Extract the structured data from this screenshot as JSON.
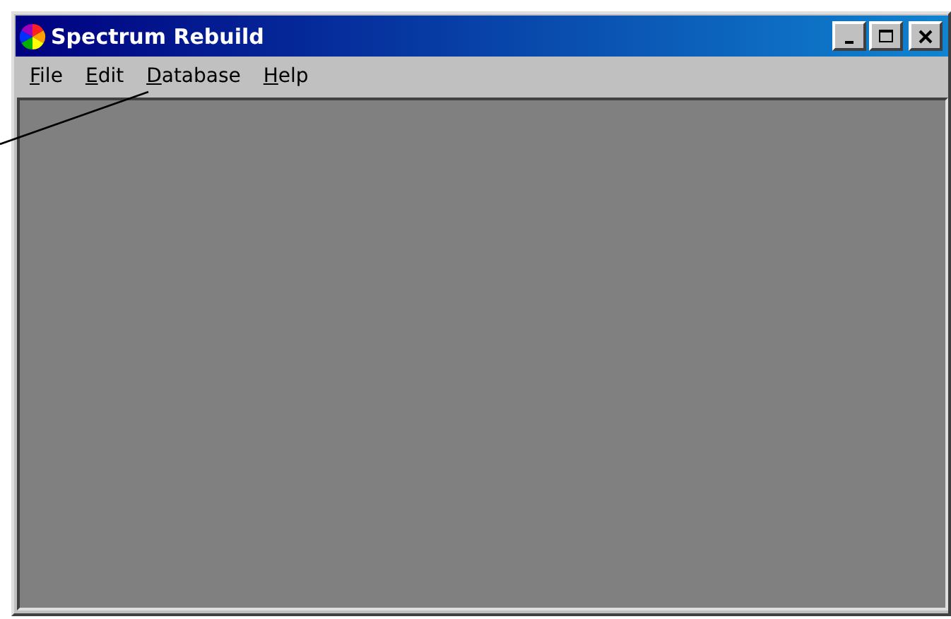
{
  "window": {
    "title": "Spectrum Rebuild"
  },
  "menu": [
    {
      "label": "File"
    },
    {
      "label": "Edit"
    },
    {
      "label": "Database"
    },
    {
      "label": "Help"
    }
  ]
}
